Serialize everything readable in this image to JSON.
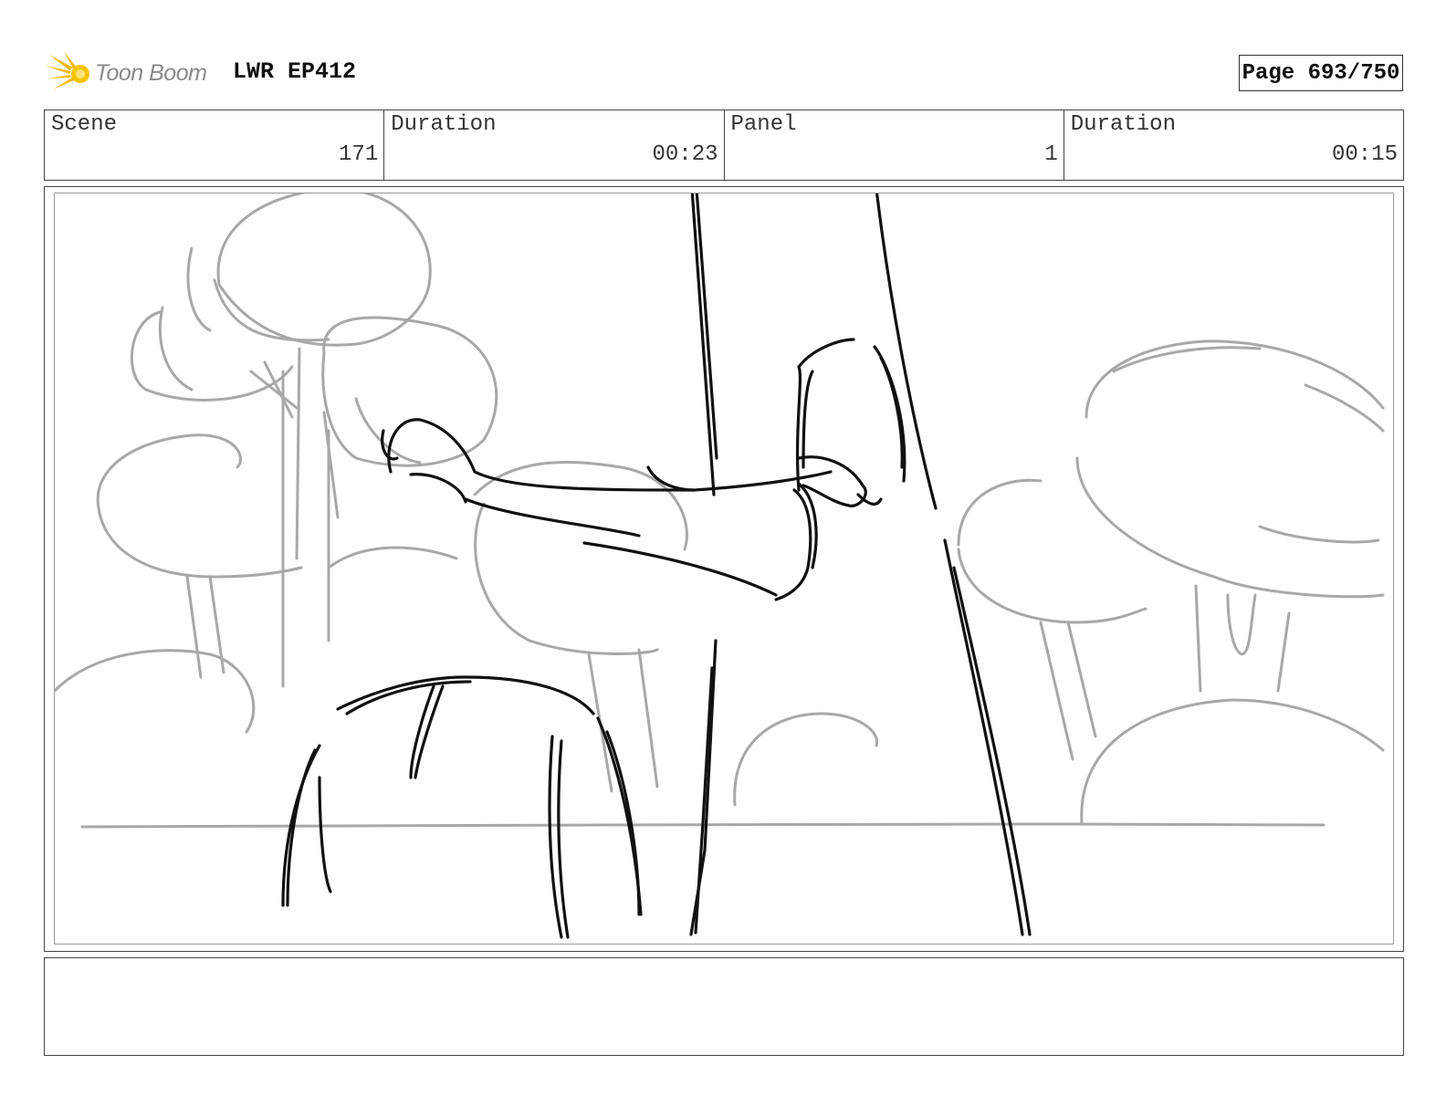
{
  "header": {
    "logo_text": "Toon Boom",
    "project": "LWR EP412",
    "page": "Page 693/750"
  },
  "info": {
    "scene_label": "Scene",
    "scene_value": "171",
    "scene_duration_label": "Duration",
    "scene_duration_value": "00:23",
    "panel_label": "Panel",
    "panel_value": "1",
    "panel_duration_label": "Duration",
    "panel_duration_value": "00:15"
  },
  "notes": {
    "text": ""
  },
  "colors": {
    "sketch_dark": "#111111",
    "sketch_light": "#a8a8a8",
    "logo_star": "#f5b800"
  },
  "icons": {
    "logo": "toon-boom-star-icon"
  }
}
